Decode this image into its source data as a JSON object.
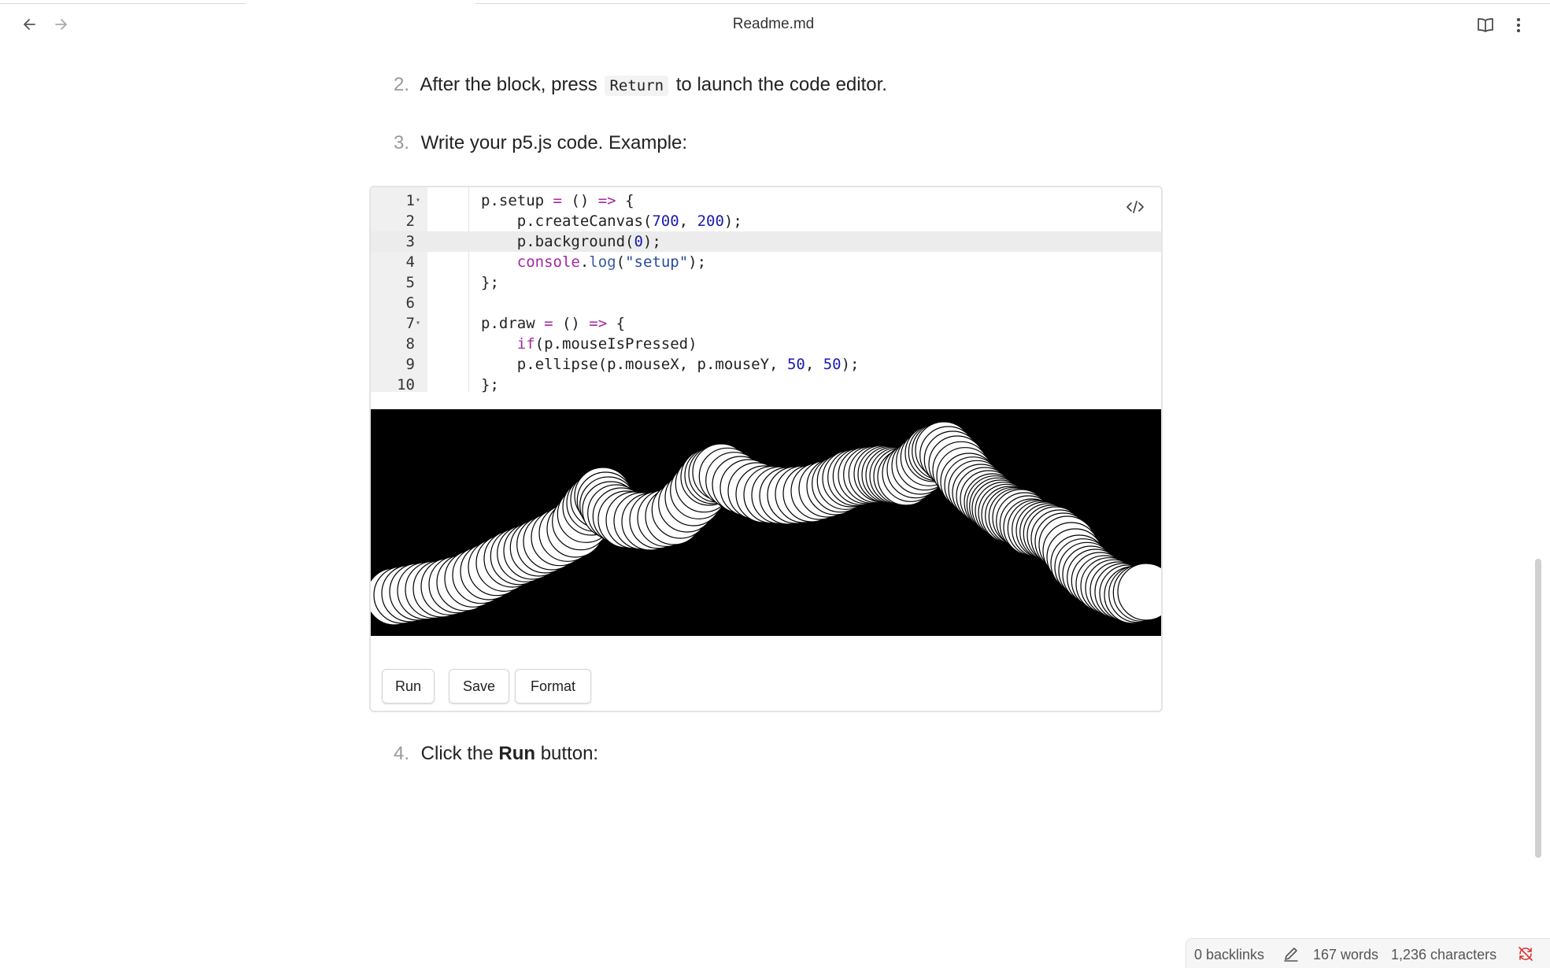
{
  "window": {
    "title": "Readme.md"
  },
  "toolbar": {
    "back_icon": "arrow-left-icon",
    "forward_icon": "arrow-right-icon",
    "reading_icon": "book-open-icon",
    "more_icon": "more-vertical-icon"
  },
  "steps": [
    {
      "num": "2.",
      "before": "After the block, press",
      "code": "Return",
      "after": "to launch the code editor."
    },
    {
      "num": "3.",
      "text": "Write your p5.js code. Example:"
    },
    {
      "num": "4.",
      "before": "Click the",
      "bold": "Run",
      "after": "button:"
    }
  ],
  "editor": {
    "line_numbers": [
      "1",
      "2",
      "3",
      "4",
      "5",
      "6",
      "7",
      "8",
      "9",
      "10"
    ],
    "toggle_icon": "code-icon",
    "lines": [
      "p.setup = () => {",
      "    p.createCanvas(700, 200);",
      "    p.background(0);",
      "    console.log(\"setup\");",
      "};",
      "",
      "p.draw = () => {",
      "    if(p.mouseIsPressed)",
      "    p.ellipse(p.mouseX, p.mouseY, 50, 50);",
      "};"
    ]
  },
  "buttons": {
    "run": "Run",
    "save": "Save",
    "format": "Format"
  },
  "status": {
    "backlinks": "0 backlinks",
    "words": "167 words",
    "characters": "1,236 characters",
    "edit_icon": "pencil-icon",
    "sync_icon": "sync-off-icon"
  },
  "colors": {
    "canvas_bg": "#000000",
    "keyword": "#a626a4",
    "number": "#1a1ab0",
    "sync_error": "#e03030"
  }
}
